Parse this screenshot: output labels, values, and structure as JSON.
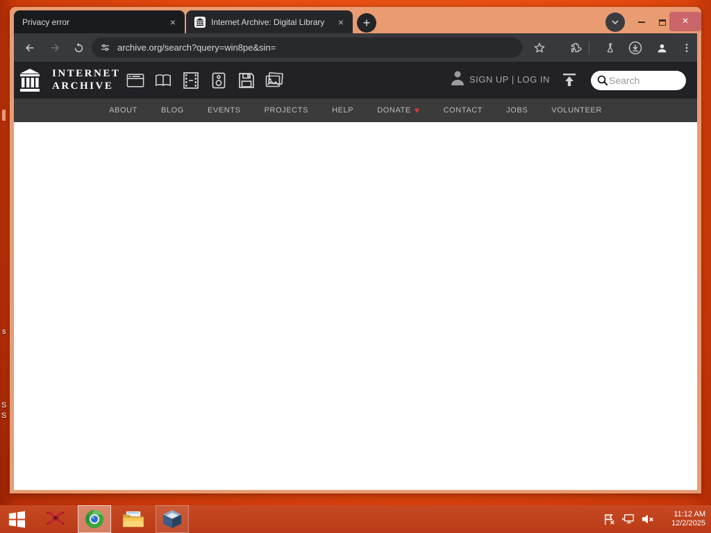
{
  "browser": {
    "tabs": [
      {
        "title": "Privacy error"
      },
      {
        "title": "Internet Archive: Digital Library"
      }
    ],
    "new_tab_glyph": "+",
    "close_glyph": "×",
    "url": "archive.org/search?query=win8pe&sin="
  },
  "ia": {
    "wordmark_line1": "INTERNET",
    "wordmark_line2": "ARCHIVE",
    "auth_text": "SIGN UP | LOG IN",
    "search_placeholder": "Search",
    "nav_items": [
      "ABOUT",
      "BLOG",
      "EVENTS",
      "PROJECTS",
      "HELP",
      "DONATE",
      "CONTACT",
      "JOBS",
      "VOLUNTEER"
    ],
    "donate_heart": "♥"
  },
  "desktop": {
    "icon_fragments": [
      "s",
      "S",
      "S"
    ]
  },
  "taskbar": {
    "clock_time": "11:12 AM",
    "clock_date": "12/2/2025"
  },
  "colors": {
    "desktop_orange": "#e54a0e",
    "titlebar_salmon": "#e99b72",
    "taskbar_red": "#c04220",
    "toolbar_gray": "#38393d",
    "ia_header_dark": "#222126",
    "ia_nav_gray": "#3b3b3b",
    "heart_red": "#e8362c",
    "close_button_rose": "#ca666a"
  }
}
